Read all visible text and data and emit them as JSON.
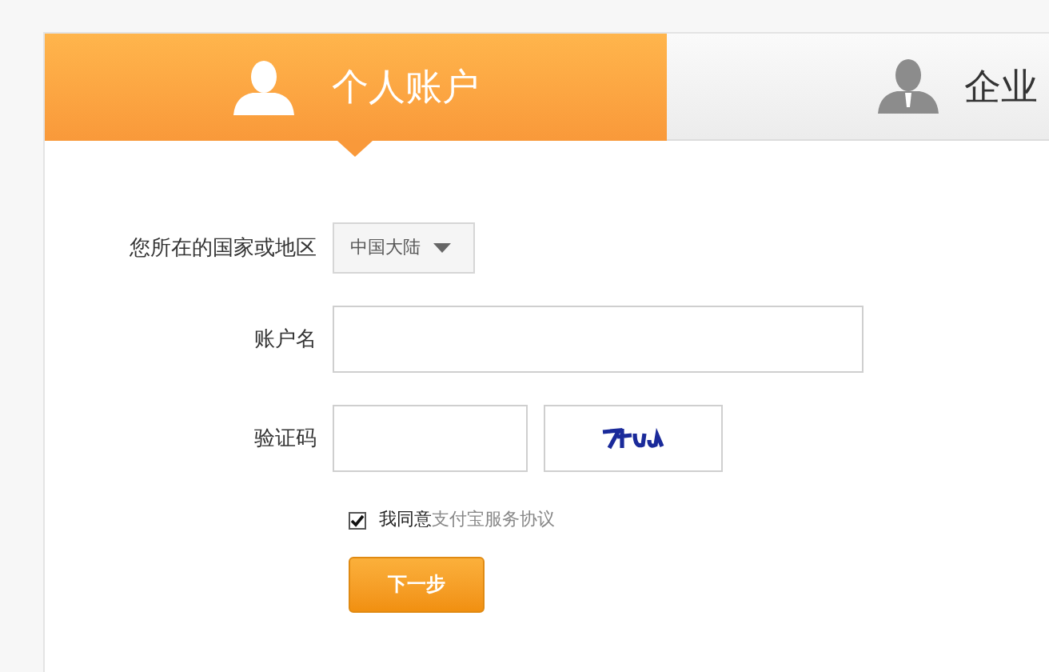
{
  "tabs": [
    {
      "label": "个人账户",
      "selected": true
    },
    {
      "label": "企业",
      "selected": false
    }
  ],
  "form": {
    "region": {
      "label": "您所在的国家或地区",
      "value": "中国大陆"
    },
    "account": {
      "label": "账户名"
    },
    "captcha": {
      "label": "验证码"
    },
    "agreement": {
      "checked": true,
      "text": "我同意",
      "link": "支付宝服务协议"
    },
    "submit": "下一步"
  }
}
